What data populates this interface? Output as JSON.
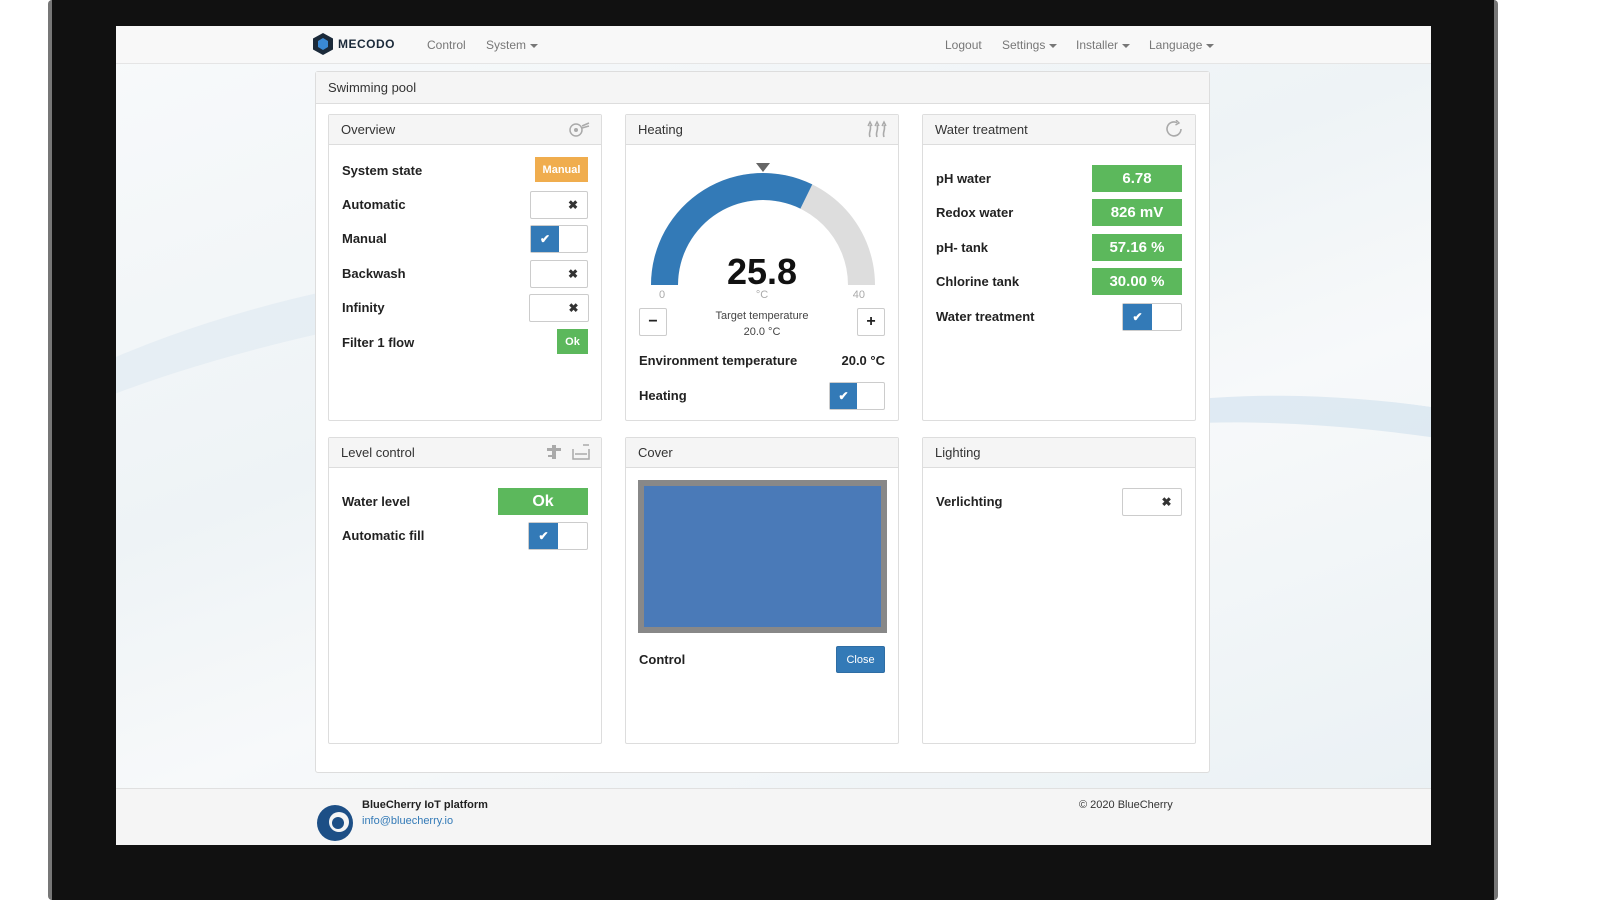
{
  "nav": {
    "brand": "MECODO",
    "left": [
      "Control",
      "System"
    ],
    "right": [
      "Logout",
      "Settings",
      "Installer",
      "Language"
    ]
  },
  "pool": {
    "title": "Swimming pool"
  },
  "overview": {
    "title": "Overview",
    "system_state_label": "System state",
    "system_state_value": "Manual",
    "automatic_label": "Automatic",
    "manual_label": "Manual",
    "backwash_label": "Backwash",
    "infinity_label": "Infinity",
    "filter_flow_label": "Filter 1 flow",
    "filter_flow_value": "Ok"
  },
  "heating": {
    "title": "Heating",
    "current": "25.8",
    "unit": "°C",
    "min": "0",
    "max": "40",
    "gauge_fraction": 0.645,
    "target_label": "Target temperature",
    "target_value": "20.0 °C",
    "env_label": "Environment temperature",
    "env_value": "20.0 °C",
    "heating_label": "Heating"
  },
  "water": {
    "title": "Water treatment",
    "ph_label": "pH water",
    "ph_value": "6.78",
    "redox_label": "Redox water",
    "redox_value": "826 mV",
    "phtank_label": "pH- tank",
    "phtank_value": "57.16 %",
    "chlorine_label": "Chlorine tank",
    "chlorine_value": "30.00 %",
    "treatment_label": "Water treatment"
  },
  "level": {
    "title": "Level control",
    "water_level_label": "Water level",
    "water_level_value": "Ok",
    "auto_fill_label": "Automatic fill"
  },
  "cover": {
    "title": "Cover",
    "control_label": "Control",
    "close_button": "Close"
  },
  "lighting": {
    "title": "Lighting",
    "verlichting_label": "Verlichting"
  },
  "footer": {
    "brand": "BlueCherry IoT platform",
    "email": "info@bluecherry.io",
    "copyright": "© 2020 BlueCherry"
  },
  "colors": {
    "primary": "#337ab7",
    "success": "#5cb85c",
    "warning": "#f0ad4e",
    "gauge_track": "#dddddd"
  }
}
